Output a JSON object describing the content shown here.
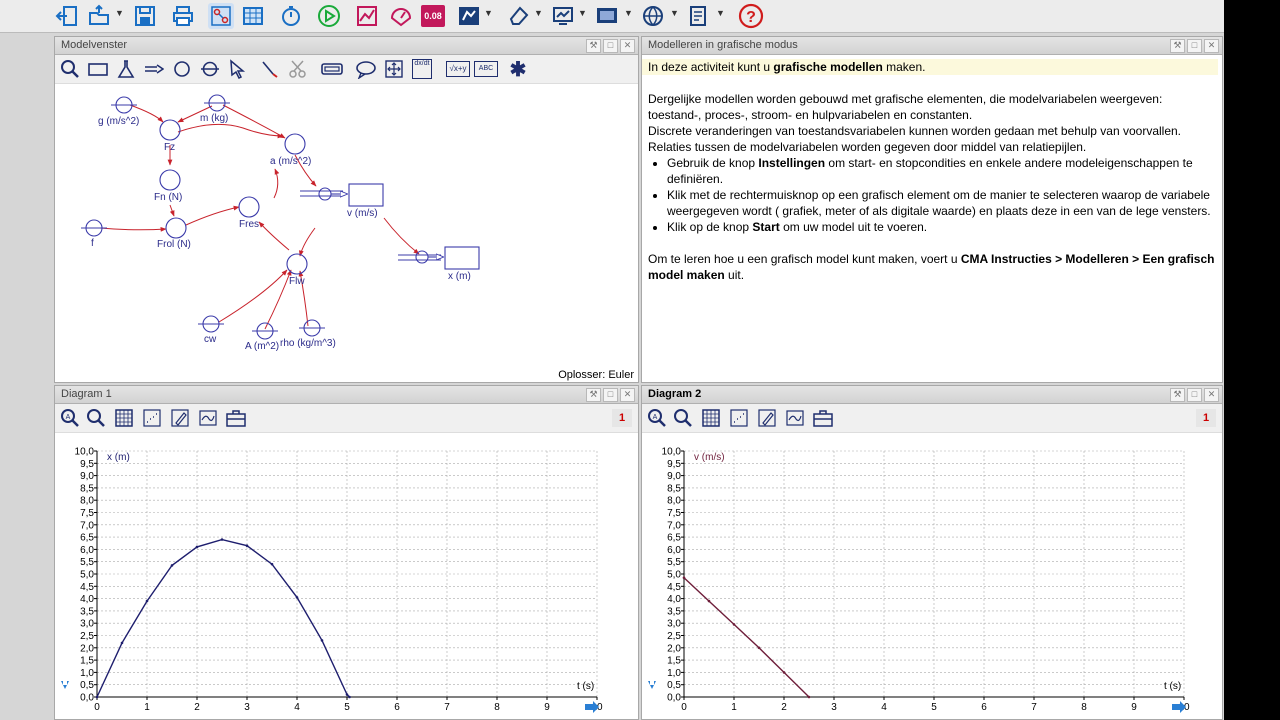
{
  "panels": {
    "model": {
      "title": "Modelvenster",
      "solver": "Oplosser: Euler"
    },
    "info": {
      "title": "Modelleren in grafische modus"
    },
    "diagram1": {
      "title": "Diagram 1",
      "badge": "1"
    },
    "diagram2": {
      "title": "Diagram 2",
      "badge": "1"
    }
  },
  "toolbar": {
    "timestep_label": "0.08",
    "icons": [
      "exit-icon",
      "open-icon",
      "save-icon",
      "print-icon",
      "model-icon",
      "table-icon",
      "timer-icon",
      "run-icon",
      "graph-icon",
      "meter-icon",
      "value-icon",
      "animation-icon",
      "eraser-icon",
      "screen-icon",
      "display-icon",
      "globe-icon",
      "document-icon",
      "help-icon"
    ]
  },
  "model": {
    "tools": [
      "zoom-icon",
      "stock-icon",
      "flask-icon",
      "flow-icon",
      "auxiliary-icon",
      "constant-icon",
      "pointer-icon",
      "relation-icon",
      "scissors-icon",
      "rectangle-icon",
      "speech-icon",
      "fit-icon",
      "derivative-icon",
      "formula-icon",
      "text-icon",
      "star-icon"
    ],
    "derivative_label": "dx/dt",
    "formula_label": "√x+y",
    "text_label": "ABC",
    "variables": {
      "g": "g (m/s^2)",
      "m": "m (kg)",
      "fz": "Fz",
      "a": "a (m/s^2)",
      "fn": "Fn (N)",
      "v": "v (m/s)",
      "f": "f",
      "frol": "Frol (N)",
      "fres": "Fres",
      "x": "x (m)",
      "flw": "Flw",
      "cw": "cw",
      "A": "A (m^2)",
      "rho": "rho (kg/m^3)"
    }
  },
  "info": {
    "intro_pre": "In deze activiteit kunt u ",
    "intro_bold": "grafische modellen",
    "intro_post": " maken.",
    "para1": "Dergelijke modellen worden gebouwd met grafische elementen, die modelvariabelen weergeven: toestand-, proces-, stroom- en hulpvariabelen en constanten.",
    "para2": "Discrete veranderingen van toestandsvariabelen kunnen worden gedaan met behulp van voorvallen.",
    "para3": "Relaties tussen de modelvariabelen worden gegeven door middel van relatiepijlen.",
    "bullet1_pre": "Gebruik de knop ",
    "bullet1_bold": "Instellingen",
    "bullet1_post": " om start- en stopcondities en enkele andere modeleigenschappen te definiëren.",
    "bullet2": "Klik met de rechtermuisknop op een grafisch element om de manier te selecteren waarop de variabele weergegeven wordt ( grafiek, meter of als digitale waarde) en plaats deze in een van de lege vensters.",
    "bullet3_pre": "Klik op de knop ",
    "bullet3_bold": "Start",
    "bullet3_post": " om uw model uit te voeren.",
    "outro_pre": "Om te leren hoe u een grafisch model kunt maken, voert u ",
    "outro_bold": "CMA Instructies > Modelleren > Een grafisch model maken",
    "outro_post": " uit."
  },
  "diagram_tools": [
    "zoom-reset-icon",
    "zoom-icon",
    "grid-icon",
    "scatter-icon",
    "pen-icon",
    "fit-icon",
    "toolbox-icon"
  ],
  "chart_data": [
    {
      "type": "line",
      "title": "",
      "xlabel": "t (s)",
      "ylabel": "x (m)",
      "xlim": [
        0,
        10
      ],
      "ylim": [
        0,
        10
      ],
      "xticks": [
        "0",
        "1",
        "2",
        "3",
        "4",
        "5",
        "6",
        "7",
        "8",
        "9",
        "10"
      ],
      "yticks": [
        "0,0",
        "0,5",
        "1,0",
        "1,5",
        "2,0",
        "2,5",
        "3,0",
        "3,5",
        "4,0",
        "4,5",
        "5,0",
        "5,5",
        "6,0",
        "6,5",
        "7,0",
        "7,5",
        "8,0",
        "8,5",
        "9,0",
        "9,5",
        "10,0"
      ],
      "grid": true,
      "color": "#1e1e6e",
      "series": [
        {
          "x": [
            0,
            0.5,
            1,
            1.5,
            2,
            2.5,
            3,
            3.5,
            4,
            4.5,
            5,
            5.05
          ],
          "y": [
            0,
            2.2,
            3.9,
            5.35,
            6.1,
            6.4,
            6.15,
            5.4,
            4.05,
            2.3,
            0.1,
            0
          ]
        }
      ]
    },
    {
      "type": "line",
      "title": "",
      "xlabel": "t (s)",
      "ylabel": "v (m/s)",
      "xlim": [
        0,
        10
      ],
      "ylim": [
        0,
        10
      ],
      "xticks": [
        "0",
        "1",
        "2",
        "3",
        "4",
        "5",
        "6",
        "7",
        "8",
        "9",
        "10"
      ],
      "yticks": [
        "0,0",
        "0,5",
        "1,0",
        "1,5",
        "2,0",
        "2,5",
        "3,0",
        "3,5",
        "4,0",
        "4,5",
        "5,0",
        "5,5",
        "6,0",
        "6,5",
        "7,0",
        "7,5",
        "8,0",
        "8,5",
        "9,0",
        "9,5",
        "10,0"
      ],
      "grid": true,
      "color": "#6e1e3a",
      "series": [
        {
          "x": [
            0,
            0.5,
            1,
            1.5,
            2,
            2.5
          ],
          "y": [
            4.85,
            3.9,
            2.95,
            2.0,
            1.0,
            0
          ]
        }
      ]
    }
  ]
}
